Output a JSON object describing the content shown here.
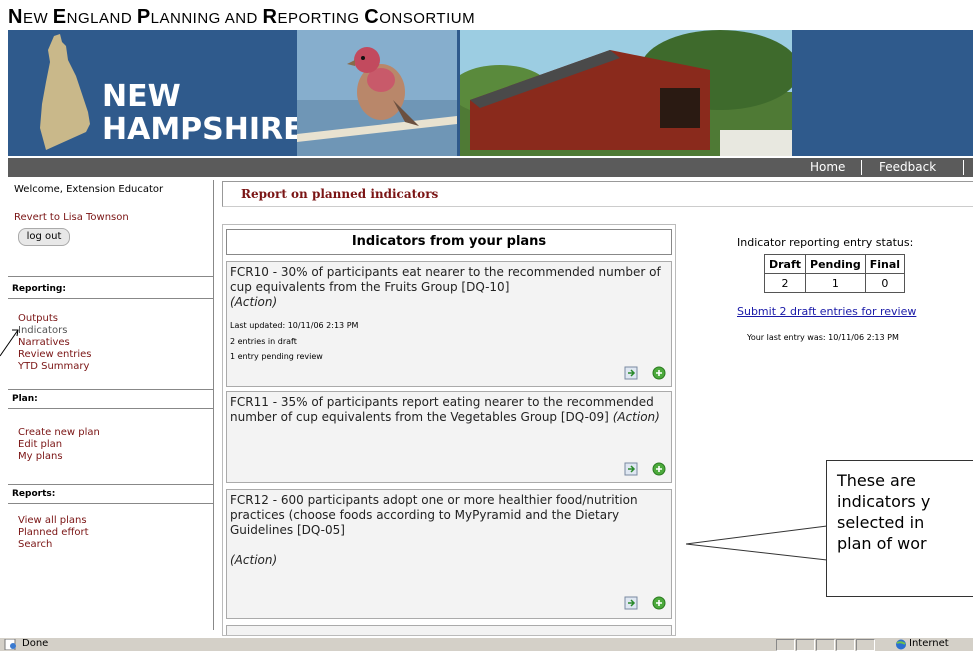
{
  "header": {
    "consortium_title": {
      "parts": [
        {
          "cap": "N",
          "rest": "EW "
        },
        {
          "cap": "E",
          "rest": "NGLAND "
        },
        {
          "cap": "P",
          "rest": "LANNING AND "
        },
        {
          "cap": "R",
          "rest": "EPORTING "
        },
        {
          "cap": "C",
          "rest": "ONSORTIUM"
        }
      ]
    },
    "state_name_line1": "NEW",
    "state_name_line2": "HAMPSHIRE"
  },
  "nav": {
    "home": "Home",
    "feedback": "Feedback"
  },
  "sidebar": {
    "welcome": "Welcome, Extension Educator",
    "revert_link": "Revert to Lisa Townson",
    "logout_label": "log out",
    "reporting_heading": "Reporting:",
    "reporting_items": [
      "Outputs",
      "Indicators",
      "Narratives",
      "Review entries",
      "YTD Summary"
    ],
    "plan_heading": "Plan:",
    "plan_items": [
      "Create new plan",
      "Edit plan",
      "My plans"
    ],
    "reports_heading": "Reports:",
    "reports_items": [
      "View all plans",
      "Planned effort",
      "Search"
    ]
  },
  "main": {
    "page_title": "Report on planned indicators",
    "plans_header": "Indicators from your plans",
    "cards": [
      {
        "text": "FCR10 - 30% of participants eat nearer to the recommended number of cup equivalents from the Fruits Group [DQ-10]",
        "action": "(Action)",
        "last_updated": "Last updated: 10/11/06 2:13 PM",
        "draft_note": "2 entries in draft",
        "pending_note": "1 entry pending review"
      },
      {
        "text": "FCR11 - 35% of participants report eating nearer to the recommended number of cup equivalents from the Vegetables Group [DQ-09]",
        "action": "(Action)"
      },
      {
        "text": "FCR12 - 600 participants adopt one or more healthier food/nutrition practices (choose foods according to MyPyramid and the Dietary Guidelines [DQ-05]",
        "action": "(Action)"
      }
    ]
  },
  "status_panel": {
    "label": "Indicator reporting entry status:",
    "columns": [
      "Draft",
      "Pending",
      "Final"
    ],
    "values": [
      "2",
      "1",
      "0"
    ],
    "submit_link": "Submit 2 draft entries for review",
    "last_entry": "Your last entry was: 10/11/06 2:13 PM"
  },
  "callout": {
    "lines": [
      "These are",
      "indicators y",
      "selected in",
      "plan of wor"
    ]
  },
  "statusbar": {
    "done": "Done",
    "zone": "Internet"
  },
  "colors": {
    "banner_blue": "#2f5a8c",
    "nav_gray": "#5b5b5b",
    "maroon_link": "#7a1414",
    "blue_link": "#1a1aa8"
  }
}
